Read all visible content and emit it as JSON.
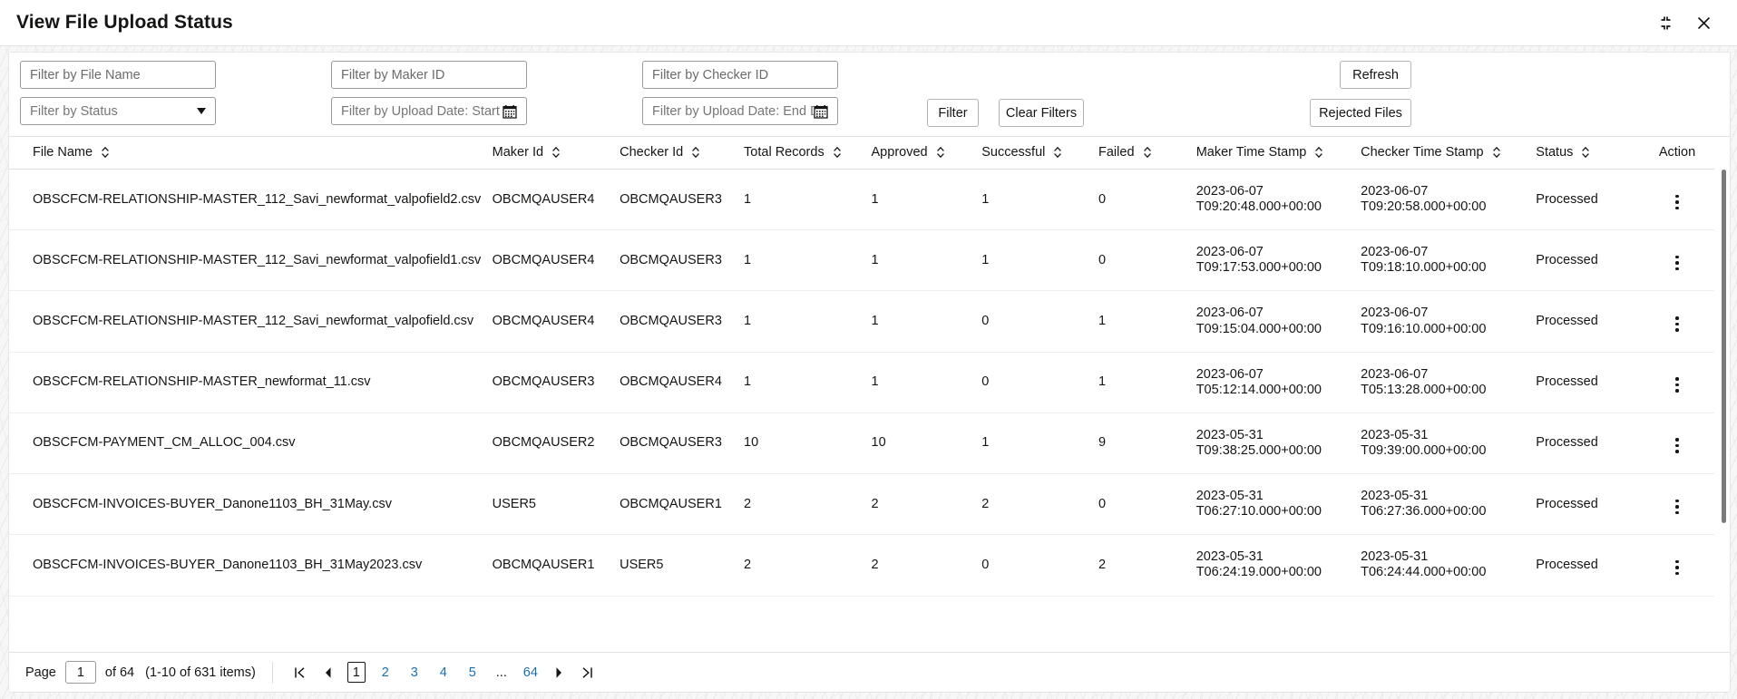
{
  "window": {
    "title": "View File Upload Status",
    "minimize_icon": "collapse-icon",
    "close_icon": "close-icon"
  },
  "filters": {
    "file_name": {
      "placeholder": "Filter by File Name",
      "value": ""
    },
    "status": {
      "placeholder": "Filter by Status",
      "value": "",
      "caret_icon": "chevron-down-icon"
    },
    "maker_id": {
      "placeholder": "Filter by Maker ID",
      "value": ""
    },
    "start_date": {
      "placeholder": "Filter by Upload Date: Start Date",
      "value": "",
      "icon": "calendar-icon"
    },
    "checker_id": {
      "placeholder": "Filter by Checker ID",
      "value": ""
    },
    "end_date": {
      "placeholder": "Filter by Upload Date: End Date",
      "value": "",
      "icon": "calendar-icon"
    },
    "buttons": {
      "filter": "Filter",
      "clear_filters": "Clear Filters",
      "refresh": "Refresh",
      "rejected_files": "Rejected Files"
    }
  },
  "table": {
    "columns": [
      {
        "label": "File Name",
        "sortable": true
      },
      {
        "label": "Maker Id",
        "sortable": true
      },
      {
        "label": "Checker Id",
        "sortable": true
      },
      {
        "label": "Total Records",
        "sortable": true
      },
      {
        "label": "Approved",
        "sortable": true
      },
      {
        "label": "Successful",
        "sortable": true
      },
      {
        "label": "Failed",
        "sortable": true
      },
      {
        "label": "Maker Time Stamp",
        "sortable": true
      },
      {
        "label": "Checker Time Stamp",
        "sortable": true
      },
      {
        "label": "Status",
        "sortable": true
      },
      {
        "label": "Action",
        "sortable": false
      }
    ],
    "rows": [
      {
        "file_name": "OBSCFCM-RELATIONSHIP-MASTER_112_Savi_newformat_valpofield2.csv",
        "maker_id": "OBCMQAUSER4",
        "checker_id": "OBCMQAUSER3",
        "total_records": "1",
        "approved": "1",
        "successful": "1",
        "failed": "0",
        "maker_time_stamp": "2023-06-07\nT09:20:48.000+00:00",
        "checker_time_stamp": "2023-06-07\nT09:20:58.000+00:00",
        "status": "Processed",
        "action_icon": "kebab-menu-icon"
      },
      {
        "file_name": "OBSCFCM-RELATIONSHIP-MASTER_112_Savi_newformat_valpofield1.csv",
        "maker_id": "OBCMQAUSER4",
        "checker_id": "OBCMQAUSER3",
        "total_records": "1",
        "approved": "1",
        "successful": "1",
        "failed": "0",
        "maker_time_stamp": "2023-06-07\nT09:17:53.000+00:00",
        "checker_time_stamp": "2023-06-07\nT09:18:10.000+00:00",
        "status": "Processed",
        "action_icon": "kebab-menu-icon"
      },
      {
        "file_name": "OBSCFCM-RELATIONSHIP-MASTER_112_Savi_newformat_valpofield.csv",
        "maker_id": "OBCMQAUSER4",
        "checker_id": "OBCMQAUSER3",
        "total_records": "1",
        "approved": "1",
        "successful": "0",
        "failed": "1",
        "maker_time_stamp": "2023-06-07\nT09:15:04.000+00:00",
        "checker_time_stamp": "2023-06-07\nT09:16:10.000+00:00",
        "status": "Processed",
        "action_icon": "kebab-menu-icon"
      },
      {
        "file_name": "OBSCFCM-RELATIONSHIP-MASTER_newformat_11.csv",
        "maker_id": "OBCMQAUSER3",
        "checker_id": "OBCMQAUSER4",
        "total_records": "1",
        "approved": "1",
        "successful": "0",
        "failed": "1",
        "maker_time_stamp": "2023-06-07\nT05:12:14.000+00:00",
        "checker_time_stamp": "2023-06-07\nT05:13:28.000+00:00",
        "status": "Processed",
        "action_icon": "kebab-menu-icon"
      },
      {
        "file_name": "OBSCFCM-PAYMENT_CM_ALLOC_004.csv",
        "maker_id": "OBCMQAUSER2",
        "checker_id": "OBCMQAUSER3",
        "total_records": "10",
        "approved": "10",
        "successful": "1",
        "failed": "9",
        "maker_time_stamp": "2023-05-31\nT09:38:25.000+00:00",
        "checker_time_stamp": "2023-05-31\nT09:39:00.000+00:00",
        "status": "Processed",
        "action_icon": "kebab-menu-icon"
      },
      {
        "file_name": "OBSCFCM-INVOICES-BUYER_Danone1103_BH_31May.csv",
        "maker_id": "USER5",
        "checker_id": "OBCMQAUSER1",
        "total_records": "2",
        "approved": "2",
        "successful": "2",
        "failed": "0",
        "maker_time_stamp": "2023-05-31\nT06:27:10.000+00:00",
        "checker_time_stamp": "2023-05-31\nT06:27:36.000+00:00",
        "status": "Processed",
        "action_icon": "kebab-menu-icon"
      },
      {
        "file_name": "OBSCFCM-INVOICES-BUYER_Danone1103_BH_31May2023.csv",
        "maker_id": "OBCMQAUSER1",
        "checker_id": "USER5",
        "total_records": "2",
        "approved": "2",
        "successful": "0",
        "failed": "2",
        "maker_time_stamp": "2023-05-31\nT06:24:19.000+00:00",
        "checker_time_stamp": "2023-05-31\nT06:24:44.000+00:00",
        "status": "Processed",
        "action_icon": "kebab-menu-icon"
      }
    ]
  },
  "pagination": {
    "page_label": "Page",
    "page_value": "1",
    "of_label": "of 64",
    "items_label": "(1-10 of 631 items)",
    "first_icon": "first-page-icon",
    "prev_icon": "previous-page-icon",
    "next_icon": "next-page-icon",
    "last_icon": "last-page-icon",
    "pages": [
      "1",
      "2",
      "3",
      "4",
      "5",
      "...",
      "64"
    ],
    "current_page": "1"
  },
  "colors": {
    "link": "#1a6fad",
    "text": "#161513",
    "border": "#9a9a9a"
  }
}
